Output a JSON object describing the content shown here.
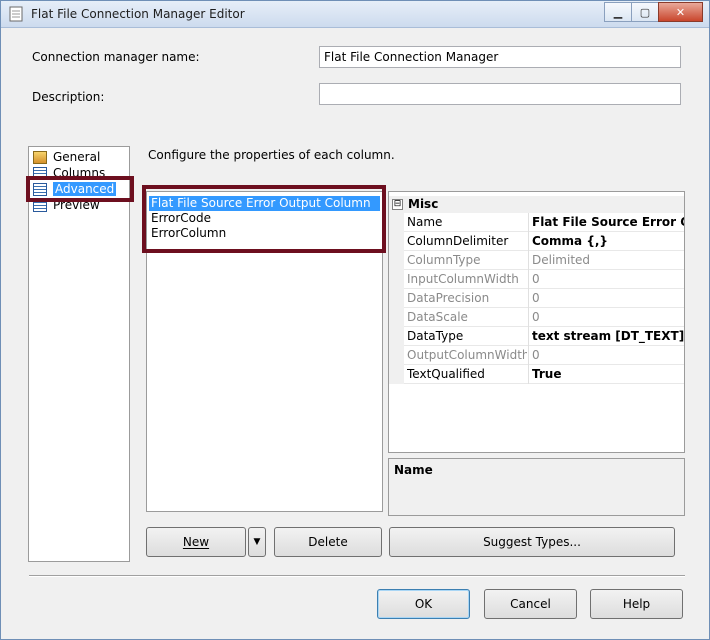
{
  "window": {
    "title": "Flat File Connection Manager Editor"
  },
  "form": {
    "connection_name_label": "Connection manager name:",
    "connection_name_value": "Flat File Connection Manager",
    "description_label": "Description:",
    "description_value": ""
  },
  "nav": {
    "items": [
      {
        "label": "General"
      },
      {
        "label": "Columns"
      },
      {
        "label": "Advanced"
      },
      {
        "label": "Preview"
      }
    ]
  },
  "main": {
    "instruction": "Configure the properties of each column.",
    "columns": [
      "Flat File Source Error Output Column",
      "ErrorCode",
      "ErrorColumn"
    ]
  },
  "propgrid": {
    "category": "Misc",
    "toggle": "⊟",
    "rows": [
      {
        "name": "Name",
        "value": "Flat File Source Error Output Column"
      },
      {
        "name": "ColumnDelimiter",
        "value": "Comma {,}"
      },
      {
        "name": "ColumnType",
        "value": "Delimited"
      },
      {
        "name": "InputColumnWidth",
        "value": "0"
      },
      {
        "name": "DataPrecision",
        "value": "0"
      },
      {
        "name": "DataScale",
        "value": "0"
      },
      {
        "name": "DataType",
        "value": "text stream [DT_TEXT]"
      },
      {
        "name": "OutputColumnWidth",
        "value": "0"
      },
      {
        "name": "TextQualified",
        "value": "True"
      }
    ],
    "description_title": "Name"
  },
  "buttons": {
    "new": "New",
    "new_dropdown": "▼",
    "delete": "Delete",
    "suggest_types": "Suggest Types...",
    "ok": "OK",
    "cancel": "Cancel",
    "help": "Help"
  },
  "colors": {
    "selection": "#3399ff",
    "highlight_border": "#6d0f1f"
  }
}
